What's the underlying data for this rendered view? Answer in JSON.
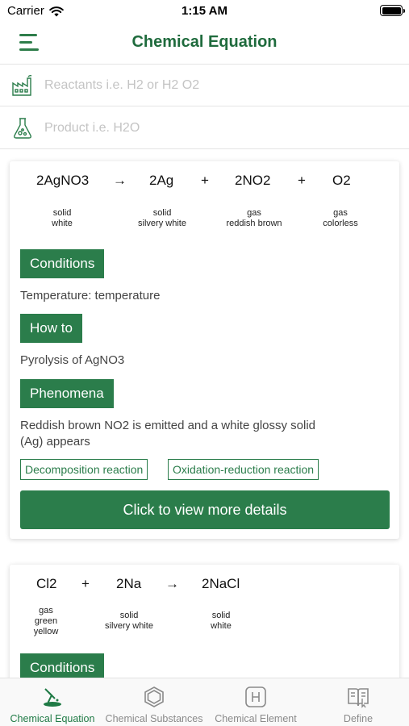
{
  "status_bar": {
    "carrier": "Carrier",
    "time": "1:15 AM"
  },
  "header": {
    "title": "Chemical Equation",
    "menu_icon": "menu-icon"
  },
  "search": {
    "reactants_placeholder": "Reactants i.e. H2 or H2 O2",
    "product_placeholder": "Product i.e. H2O",
    "reactants_icon": "factory-icon",
    "product_icon": "flask-icon"
  },
  "cards": [
    {
      "equation": [
        {
          "text": "2AgNO3",
          "type": "substance"
        },
        {
          "text": "→",
          "type": "operator"
        },
        {
          "text": "2Ag",
          "type": "substance"
        },
        {
          "text": "+",
          "type": "operator"
        },
        {
          "text": "2NO2",
          "type": "substance"
        },
        {
          "text": "+",
          "type": "operator"
        },
        {
          "text": "O2",
          "type": "substance"
        }
      ],
      "states": [
        [
          "solid",
          "white"
        ],
        [
          "solid",
          "silvery white"
        ],
        [
          "gas",
          "reddish brown"
        ],
        [
          "gas",
          "colorless"
        ]
      ],
      "conditions_label": "Conditions",
      "conditions_text": "Temperature: temperature",
      "howto_label": "How to",
      "howto_text": "Pyrolysis of AgNO3",
      "phenomena_label": "Phenomena",
      "phenomena_text_line1": "Reddish brown NO2 is emitted and a white glossy solid",
      "phenomena_text_line2": "(Ag) appears",
      "tags": [
        "Decomposition reaction",
        "Oxidation-reduction reaction"
      ],
      "details_label": "Click to view more details"
    },
    {
      "equation": [
        {
          "text": "Cl2",
          "type": "substance"
        },
        {
          "text": "+",
          "type": "operator"
        },
        {
          "text": "2Na",
          "type": "substance"
        },
        {
          "text": "→",
          "type": "operator"
        },
        {
          "text": "2NaCl",
          "type": "substance"
        }
      ],
      "states": [
        [
          "gas",
          "green",
          "yellow"
        ],
        [
          "solid",
          "silvery white"
        ],
        [
          "solid",
          "white"
        ]
      ],
      "conditions_label": "Conditions"
    }
  ],
  "tab_bar": {
    "tabs": [
      {
        "label": "Chemical Equation",
        "icon": "flask-pour-icon",
        "active": true
      },
      {
        "label": "Chemical Substances",
        "icon": "hexagon-icon",
        "active": false
      },
      {
        "label": "Chemical Element",
        "icon": "element-h-icon",
        "active": false
      },
      {
        "label": "Define",
        "icon": "book-icon",
        "active": false
      }
    ]
  },
  "colors": {
    "brand_green": "#2b7d4b",
    "title_green": "#1f6b3d"
  }
}
